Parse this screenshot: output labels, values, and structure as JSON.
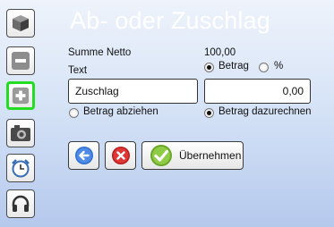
{
  "window": {
    "title": "Ab- oder Zuschlag"
  },
  "sidebar": {
    "items": [
      {
        "icon": "package-icon"
      },
      {
        "icon": "minus-icon"
      },
      {
        "icon": "plus-icon",
        "selected": true
      },
      {
        "icon": "camera-icon"
      },
      {
        "icon": "alarm-clock-icon"
      },
      {
        "icon": "headphones-icon"
      }
    ]
  },
  "form": {
    "summe_netto_label": "Summe Netto",
    "summe_netto_value": "100,00",
    "type_options": {
      "betrag": "Betrag",
      "prozent": "%",
      "selected": "Betrag"
    },
    "text_label": "Text",
    "text_value": "Zuschlag",
    "amount_value": "0,00",
    "mode_options": {
      "abziehen": "Betrag abziehen",
      "dazurechnen": "Betrag dazurechnen",
      "selected": "Betrag dazurechnen"
    }
  },
  "actions": {
    "back_icon": "arrow-left-icon",
    "cancel_icon": "close-icon",
    "apply_label": "Übernehmen",
    "apply_icon": "checkmark-icon"
  },
  "colors": {
    "selected_border": "#22dd22",
    "back": "#2f6fd0",
    "cancel": "#d42a2a",
    "apply": "#77b72d"
  }
}
